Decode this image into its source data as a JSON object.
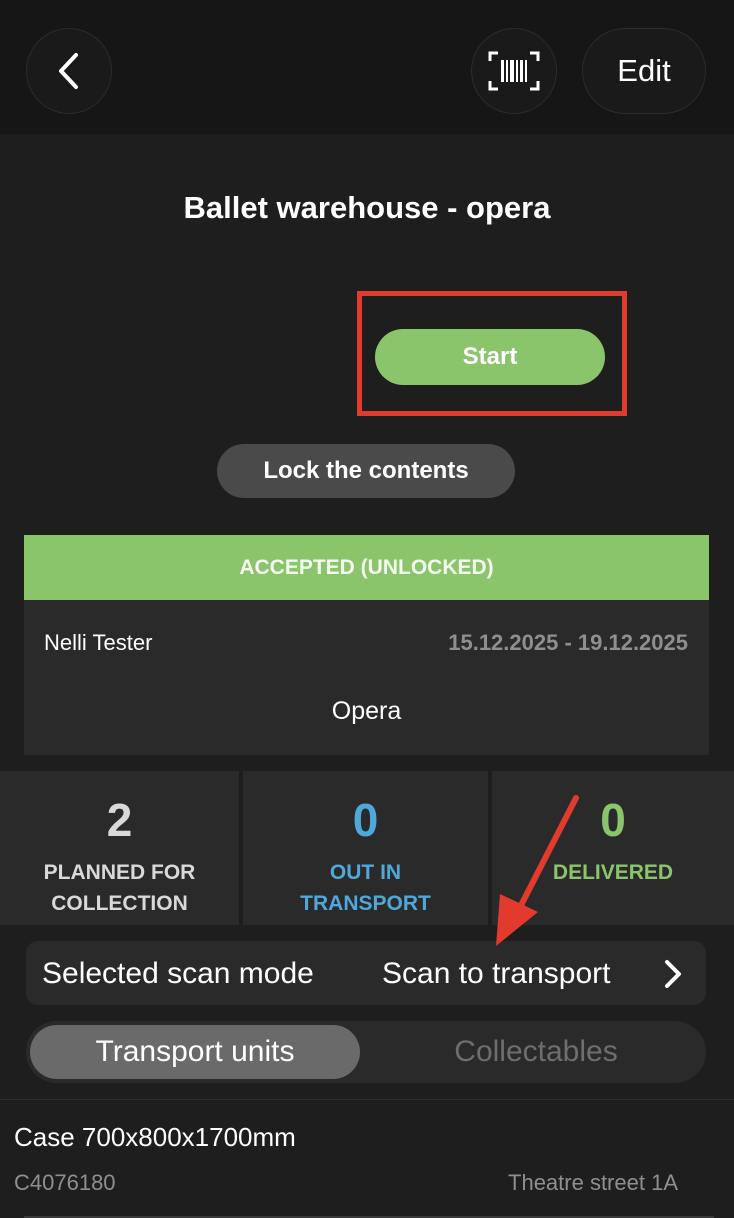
{
  "header": {
    "back_icon": "chevron-left-icon",
    "scan_icon": "barcode-scan-icon",
    "edit_label": "Edit"
  },
  "title": "Ballet warehouse - opera",
  "actions": {
    "start_label": "Start",
    "lock_label": "Lock the contents"
  },
  "status": {
    "label": "ACCEPTED (UNLOCKED)",
    "person": "Nelli Tester",
    "dates": "15.12.2025 - 19.12.2025",
    "location": "Opera",
    "color": "#8bc56b"
  },
  "stats": [
    {
      "count": "2",
      "line1": "PLANNED FOR",
      "line2": "COLLECTION",
      "color": "#d9d9d9"
    },
    {
      "count": "0",
      "line1": "OUT IN",
      "line2": "TRANSPORT",
      "color": "#4ea8dc"
    },
    {
      "count": "0",
      "line1": "DELIVERED",
      "line2": "",
      "color": "#8bc56b"
    }
  ],
  "scan_mode": {
    "label": "Selected scan mode",
    "value": "Scan to transport"
  },
  "tabs": {
    "active": "Transport units",
    "inactive": "Collectables"
  },
  "items": [
    {
      "title": "Case 700x800x1700mm",
      "code": "C4076180",
      "address": "Theatre street 1A"
    }
  ],
  "annotation_color": "#e23a2c"
}
